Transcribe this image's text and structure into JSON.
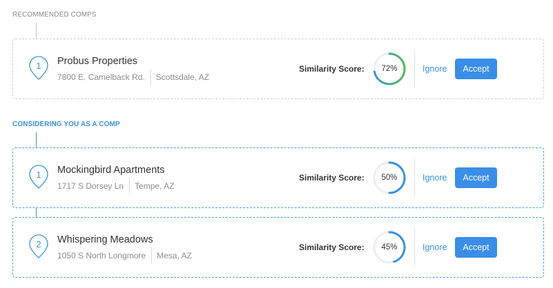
{
  "recommended": {
    "label": "RECOMMENDED COMPS",
    "items": [
      {
        "number": "1",
        "name": "Probus Properties",
        "street": "7800 E. Camelback Rd.",
        "city": "Scottsdale, AZ",
        "similarity_label": "Similarity Score:",
        "score_text": "72%",
        "score_value": 72,
        "ignore_label": "Ignore",
        "accept_label": "Accept"
      }
    ]
  },
  "considering": {
    "label": "CONSIDERING YOU AS A COMP",
    "items": [
      {
        "number": "1",
        "name": "Mockingbird Apartments",
        "street": "1717 S Dorsey Ln",
        "city": "Tempe, AZ",
        "similarity_label": "Similarity Score:",
        "score_text": "50%",
        "score_value": 50,
        "ignore_label": "Ignore",
        "accept_label": "Accept"
      },
      {
        "number": "2",
        "name": "Whispering Meadows",
        "street": "1050 S North Longmore",
        "city": "Mesa, AZ",
        "similarity_label": "Similarity Score:",
        "score_text": "45%",
        "score_value": 45,
        "ignore_label": "Ignore",
        "accept_label": "Accept"
      }
    ]
  },
  "colors": {
    "accent": "#3a8ee8",
    "gauge_blue": "#3a92e0",
    "gauge_green": "#5cb85c",
    "gauge_track": "#eeeeee",
    "gray_border": "#d0d0d0"
  }
}
